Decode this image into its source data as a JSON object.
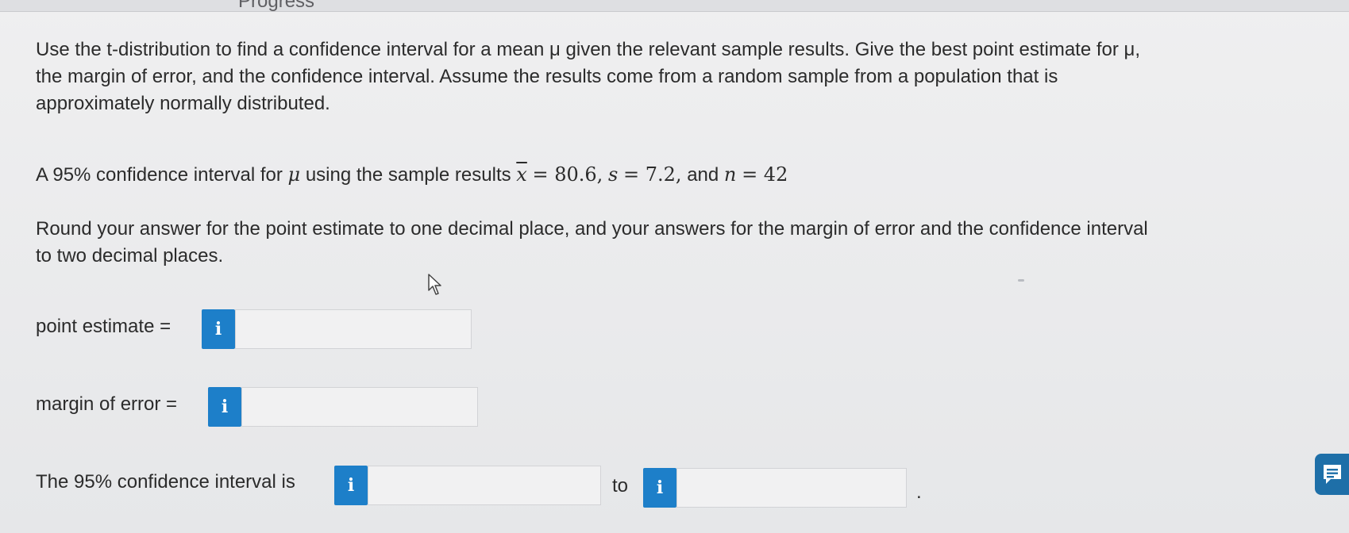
{
  "header": {
    "partial_title": "Progress"
  },
  "problem": {
    "intro_line1": "Use the t-distribution to find a confidence interval for a mean μ given the relevant sample results. Give the best point estimate for μ,",
    "intro_line2": "the margin of error, and the confidence interval. Assume the results come from a random sample from a population that is",
    "intro_line3": "approximately normally distributed.",
    "given_prefix": "A 95% confidence interval for",
    "given_mu": "μ",
    "given_mid": "using the sample results",
    "given_xbar": "x",
    "given_xbar_value": "= 80.6,",
    "given_s": "s",
    "given_s_value": "= 7.2,",
    "given_and": "and",
    "given_n": "n",
    "given_n_value": "= 42",
    "round_line1": "Round your answer for the point estimate to one decimal place, and your answers for the margin of error and the confidence interval",
    "round_line2": "to two decimal places."
  },
  "answers": {
    "point_estimate_label": "point estimate =",
    "point_estimate_value": "",
    "margin_label": "margin of error =",
    "margin_value": "",
    "ci_label": "The 95% confidence interval is",
    "ci_lower_value": "",
    "ci_to": "to",
    "ci_upper_value": "",
    "ci_period": ".",
    "info_glyph": "i"
  },
  "icons": {
    "info": "info-icon",
    "cursor": "mouse-pointer-icon",
    "chat": "chat-icon"
  },
  "colors": {
    "accent": "#1d7fc9",
    "chat": "#1e6fa8"
  }
}
